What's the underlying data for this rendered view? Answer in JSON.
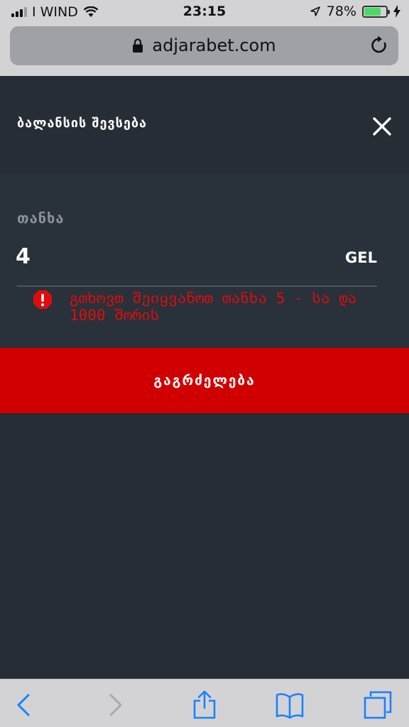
{
  "status_bar": {
    "carrier": "I WIND",
    "time": "23:15",
    "battery_percent": "78%",
    "battery_level": 0.78
  },
  "browser": {
    "url": "adjarabet.com"
  },
  "modal": {
    "title": "ბალანსის შევსება",
    "amount_label": "თანხა",
    "amount_value": "4",
    "currency": "GEL",
    "error_message": "გთხოვთ შეიყვანოთ თანხა 5 - სა და 1000 შორის",
    "continue_label": "გაგრძელება"
  },
  "colors": {
    "background": "#262d35",
    "button_red": "#d10000",
    "error_red": "#e00c0c",
    "ios_blue": "#1a82fb"
  },
  "toolbar": {
    "icons": [
      "back-icon",
      "forward-icon",
      "share-icon",
      "bookmarks-icon",
      "tabs-icon"
    ]
  }
}
